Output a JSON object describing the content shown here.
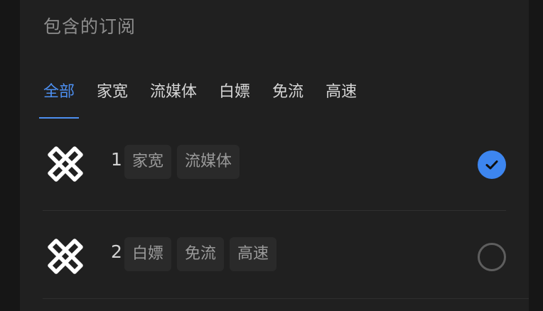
{
  "section": {
    "title": "包含的订阅"
  },
  "tabs": [
    {
      "label": "全部",
      "active": true
    },
    {
      "label": "家宽",
      "active": false
    },
    {
      "label": "流媒体",
      "active": false
    },
    {
      "label": "白嫖",
      "active": false
    },
    {
      "label": "免流",
      "active": false
    },
    {
      "label": "高速",
      "active": false
    }
  ],
  "subscriptions": [
    {
      "number": "1",
      "tags": [
        "家宽",
        "流媒体"
      ],
      "selected": true,
      "icon": "knot-logo-icon"
    },
    {
      "number": "2",
      "tags": [
        "白嫖",
        "免流",
        "高速"
      ],
      "selected": false,
      "icon": "knot-logo-icon"
    }
  ],
  "colors": {
    "accent": "#4d8ff0",
    "check_fill": "#3d86f0",
    "panel": "#202020",
    "chip": "#2a2a2a"
  }
}
